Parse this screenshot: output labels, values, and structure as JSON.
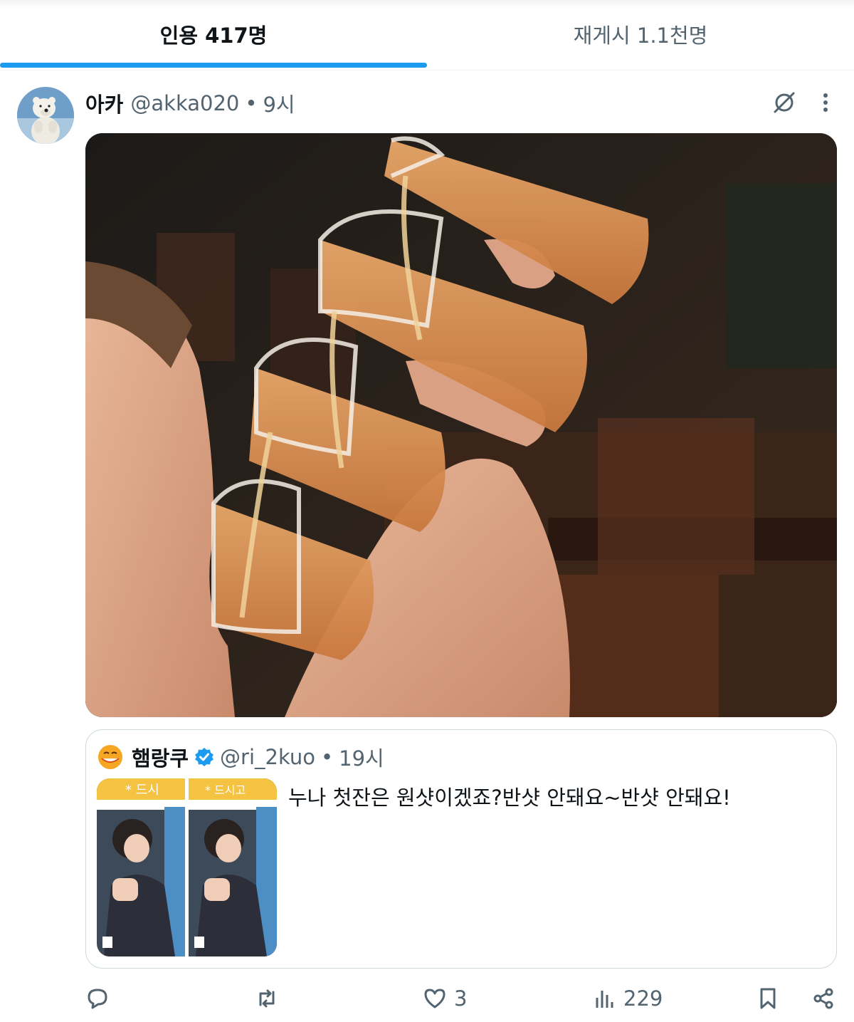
{
  "tabs": [
    {
      "label": "인용 417명",
      "selected": true
    },
    {
      "label": "재게시 1.1천명",
      "selected": false
    }
  ],
  "colors": {
    "accent": "#1d9bf0",
    "muted": "#536471",
    "text": "#0f1419",
    "border": "#cfd9de"
  },
  "tweet": {
    "display_name": "아카",
    "handle": "@akka020",
    "separator": "•",
    "time": "9시",
    "media": "photo-man-drinking-stacked-beer-cups"
  },
  "quoted": {
    "display_name": "햄랑쿠",
    "verified": true,
    "handle": "@ri_2kuo",
    "separator": "•",
    "time": "19시",
    "text": "누나 첫잔은 원샷이겠죠?반샷 안돼요~반샷 안돼요!",
    "thumb_signs": [
      "* 드시",
      "* 드시고"
    ]
  },
  "actions": {
    "reply_icon": "reply-icon",
    "retweet_icon": "retweet-icon",
    "like_icon": "heart-icon",
    "like_count": "3",
    "views_icon": "views-icon",
    "view_count": "229",
    "bookmark_icon": "bookmark-icon",
    "share_icon": "share-icon"
  }
}
